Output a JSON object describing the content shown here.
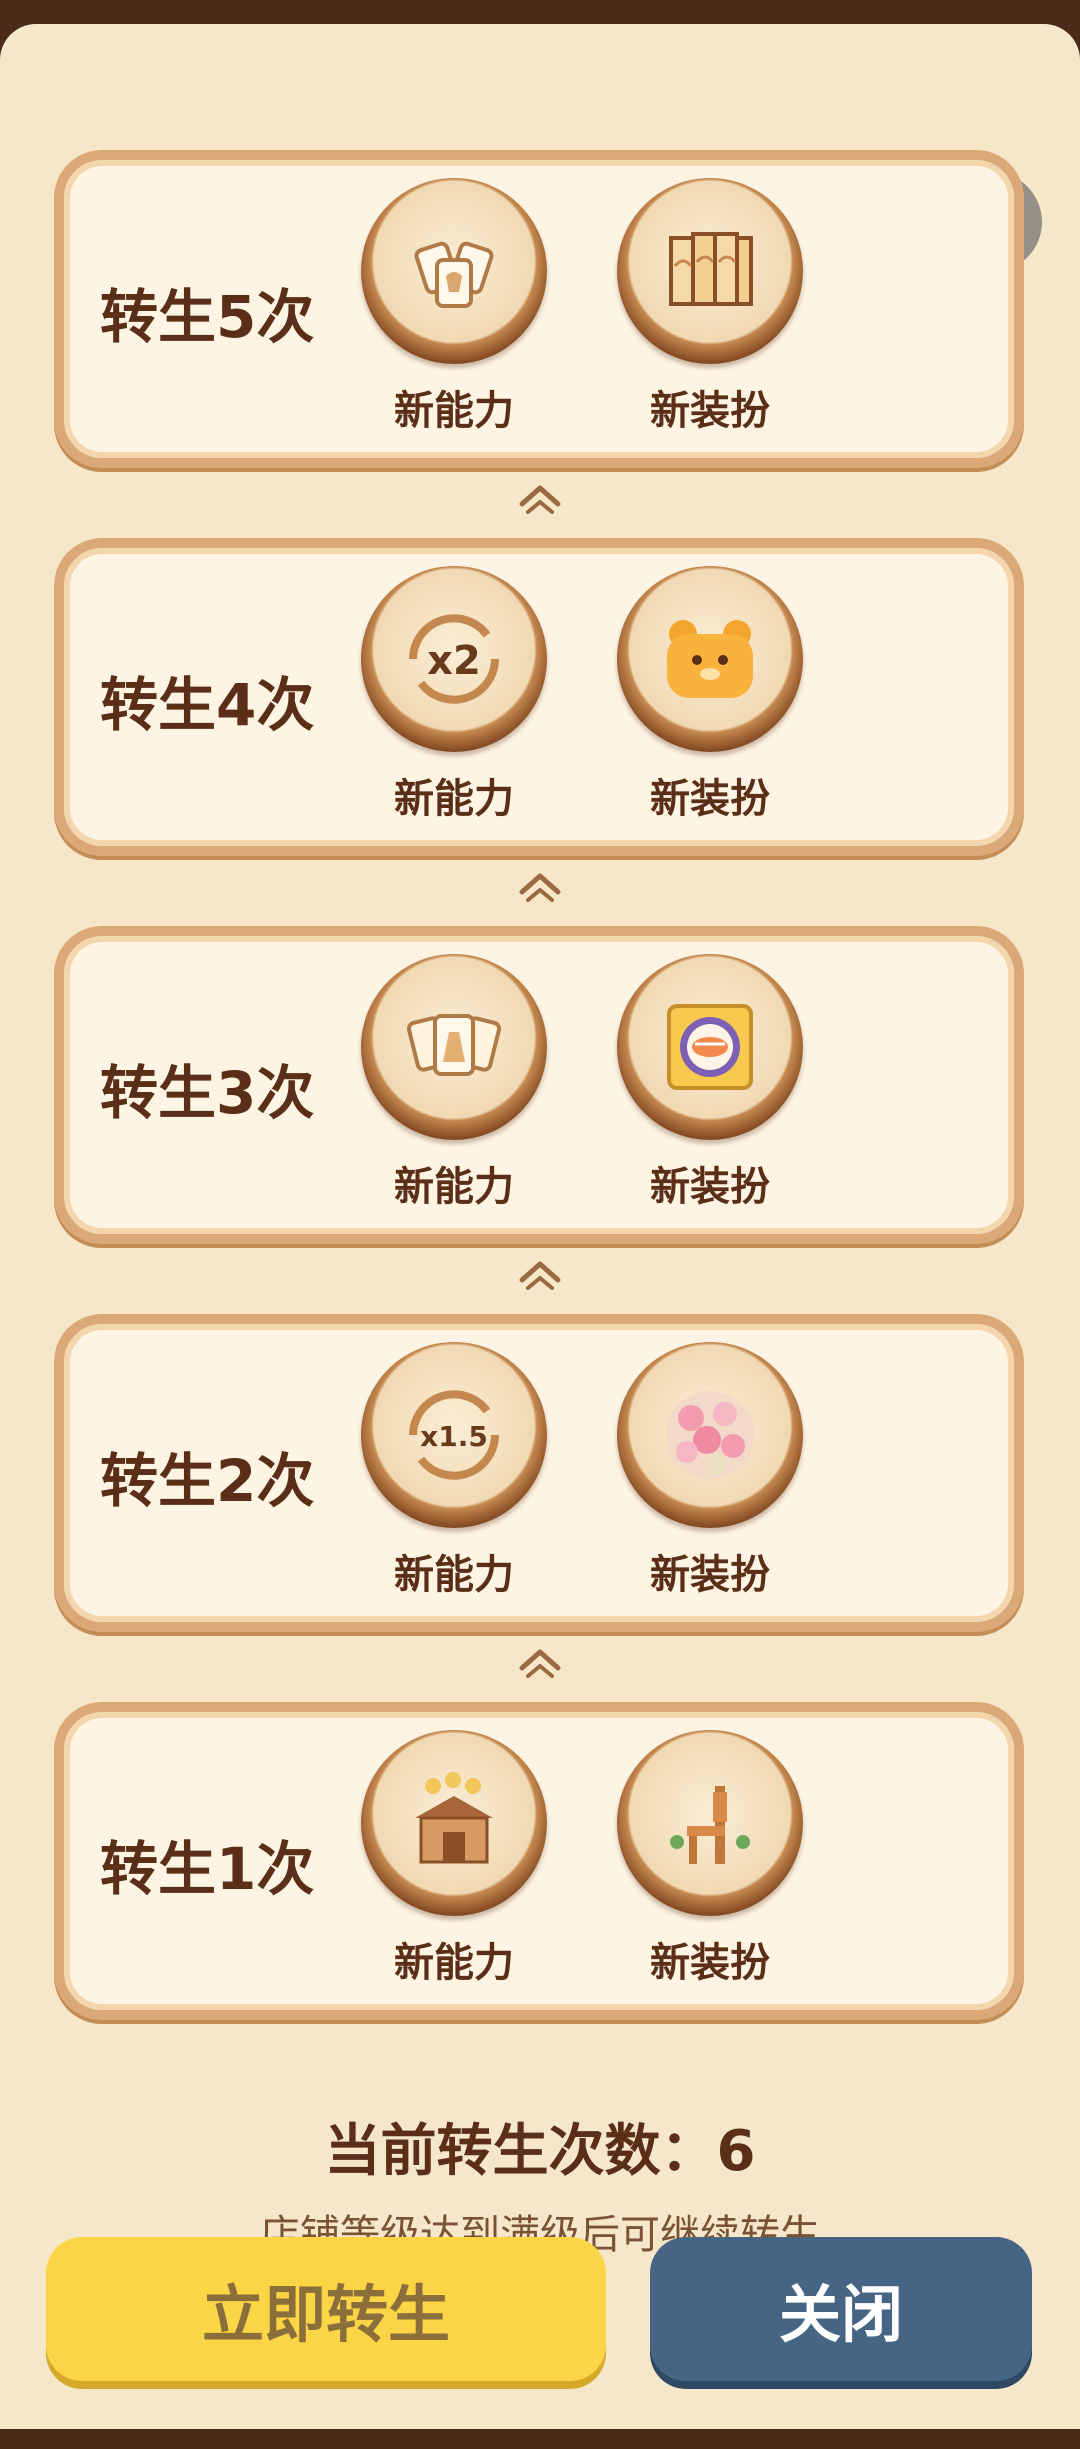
{
  "top_capsule": {
    "more_icon": "more-dots-icon",
    "close_icon": "target-circle-icon"
  },
  "tiers": [
    {
      "title": "转生5次",
      "ability_label": "新能力",
      "outfit_label": "新装扮",
      "ability_icon": "clothing-cards-icon",
      "outfit_icon": "folding-screen-icon"
    },
    {
      "title": "转生4次",
      "ability_label": "新能力",
      "outfit_label": "新装扮",
      "ability_icon": "x2-multiplier-icon",
      "ability_text": "x2",
      "outfit_icon": "bear-cushion-icon"
    },
    {
      "title": "转生3次",
      "ability_label": "新能力",
      "outfit_label": "新装扮",
      "ability_icon": "dress-cards-icon",
      "outfit_icon": "sushi-plate-icon"
    },
    {
      "title": "转生2次",
      "ability_label": "新能力",
      "outfit_label": "新装扮",
      "ability_icon": "x1.5-multiplier-icon",
      "ability_text": "x1.5",
      "outfit_icon": "cherry-blossom-icon"
    },
    {
      "title": "转生1次",
      "ability_label": "新能力",
      "outfit_label": "新装扮",
      "ability_icon": "shop-coins-icon",
      "outfit_icon": "wooden-chair-icon"
    }
  ],
  "footer": {
    "current_count": "当前转生次数：6",
    "hint": "店铺等级达到满级后可继续转生"
  },
  "buttons": {
    "rebirth_label": "立即转生",
    "close_label": "关闭"
  },
  "colors": {
    "background": "#f6e7c9",
    "card_border": "#dba977",
    "text_brown": "#5a2e17",
    "rebirth_button": "#fbd546",
    "close_button": "#466585"
  }
}
